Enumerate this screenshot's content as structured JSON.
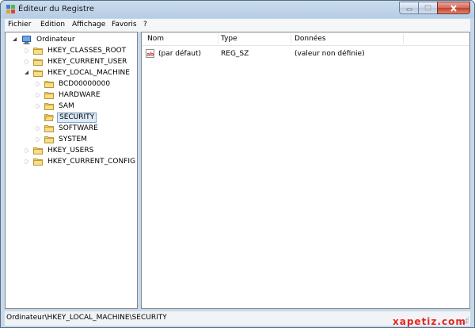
{
  "window": {
    "title": "Éditeur du Registre"
  },
  "menu": [
    "Fichier",
    "Edition",
    "Affichage",
    "Favoris",
    "?"
  ],
  "tree": [
    {
      "label": "Ordinateur",
      "level": 0,
      "expander": "open",
      "icon": "computer-icon"
    },
    {
      "label": "HKEY_CLASSES_ROOT",
      "level": 1,
      "expander": "closed",
      "icon": "folder-icon"
    },
    {
      "label": "HKEY_CURRENT_USER",
      "level": 1,
      "expander": "closed",
      "icon": "folder-icon"
    },
    {
      "label": "HKEY_LOCAL_MACHINE",
      "level": 1,
      "expander": "open",
      "icon": "folder-icon"
    },
    {
      "label": "BCD00000000",
      "level": 2,
      "expander": "closed",
      "icon": "folder-icon"
    },
    {
      "label": "HARDWARE",
      "level": 2,
      "expander": "closed",
      "icon": "folder-icon"
    },
    {
      "label": "SAM",
      "level": 2,
      "expander": "closed",
      "icon": "folder-icon"
    },
    {
      "label": "SECURITY",
      "level": 2,
      "expander": "none",
      "icon": "folder-open-icon",
      "selected": true
    },
    {
      "label": "SOFTWARE",
      "level": 2,
      "expander": "closed",
      "icon": "folder-icon"
    },
    {
      "label": "SYSTEM",
      "level": 2,
      "expander": "closed",
      "icon": "folder-icon"
    },
    {
      "label": "HKEY_USERS",
      "level": 1,
      "expander": "closed",
      "icon": "folder-icon"
    },
    {
      "label": "HKEY_CURRENT_CONFIG",
      "level": 1,
      "expander": "closed",
      "icon": "folder-icon"
    }
  ],
  "list": {
    "columns": [
      "Nom",
      "Type",
      "Données"
    ],
    "rows": [
      {
        "icon": "string-value-icon",
        "name": "(par défaut)",
        "type": "REG_SZ",
        "data": "(valeur non définie)"
      }
    ]
  },
  "status": {
    "path": "Ordinateur\\HKEY_LOCAL_MACHINE\\SECURITY"
  },
  "watermark": "xapetiz.com",
  "colors": {
    "selection": "#dceaf8",
    "window_frame": "#c6d9ec",
    "close_button": "#c2412a",
    "watermark": "#e2281f"
  }
}
